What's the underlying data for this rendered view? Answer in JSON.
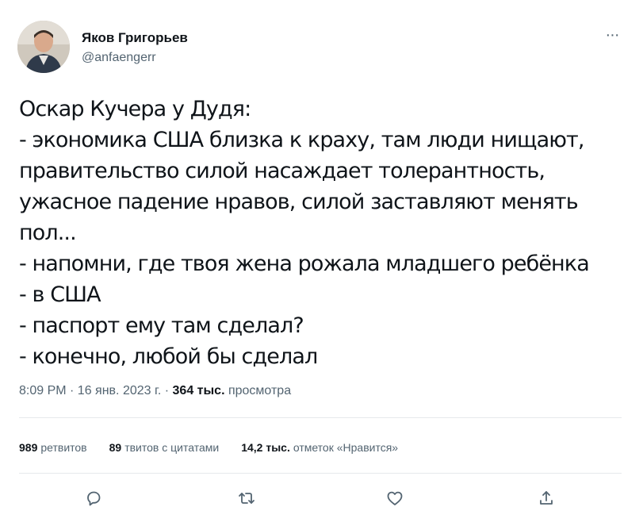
{
  "author": {
    "name": "Яков Григорьев",
    "handle": "@anfaengerr"
  },
  "tweet": {
    "lines": [
      "Оскар Кучера у Дудя:",
      "- экономика США близка к краху, там люди нищают,",
      "правительство силой насаждает толерантность,",
      "ужасное падение нравов, силой заставляют менять",
      "пол...",
      "- напомни, где твоя жена рожала младшего ребёнка",
      "- в США",
      "- паспорт ему там сделал?",
      "- конечно, любой бы сделал"
    ]
  },
  "meta": {
    "time_date": "8:09 PM · 16 янв. 2023 г. ·",
    "views_count": "364 тыс.",
    "views_label": "просмотра"
  },
  "stats": {
    "retweets_count": "989",
    "retweets_label": "ретвитов",
    "quotes_count": "89",
    "quotes_label": "твитов с цитатами",
    "likes_count": "14,2 тыс.",
    "likes_label": "отметок «Нравится»"
  },
  "actions": {
    "reply_icon": "speech-bubble",
    "retweet_icon": "retweet-arrows",
    "like_icon": "heart",
    "share_icon": "upload-arrow"
  },
  "colors": {
    "text": "#0f1419",
    "secondary": "#536471",
    "divider": "#e6e9ec"
  }
}
